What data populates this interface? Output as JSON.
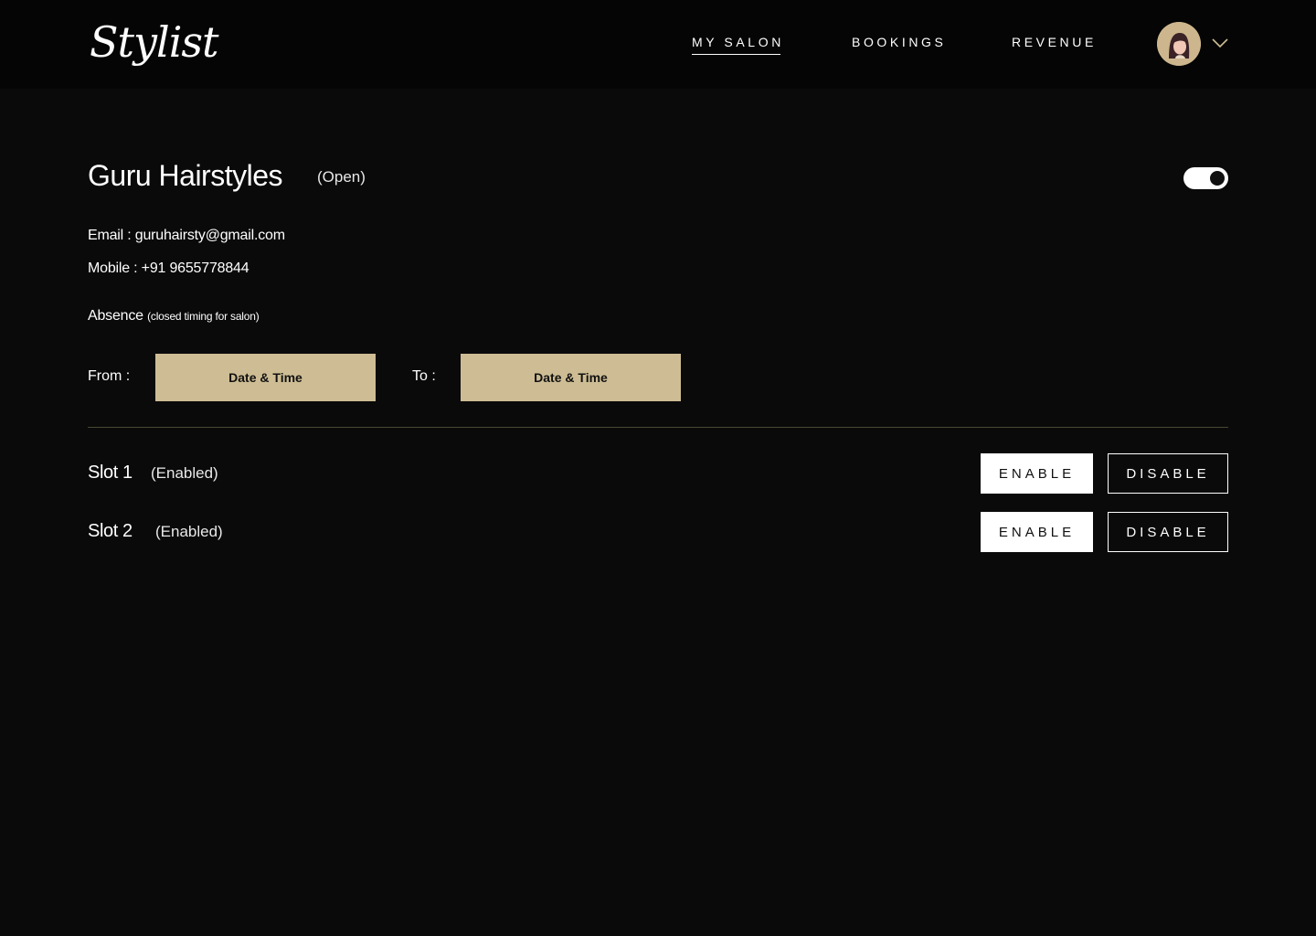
{
  "brand": {
    "logo_text": "Stylist"
  },
  "nav": {
    "items": [
      {
        "label": "MY SALON",
        "active": true
      },
      {
        "label": "BOOKINGS",
        "active": false
      },
      {
        "label": "REVENUE",
        "active": false
      }
    ]
  },
  "salon": {
    "name": "Guru Hairstyles",
    "status": "(Open)",
    "email_line": "Email : guruhairsty@gmail.com",
    "mobile_line": "Mobile : +91 9655778844",
    "open": true
  },
  "absence": {
    "label": "Absence",
    "note": "(closed timing for salon)",
    "from_label": "From :",
    "to_label": "To :",
    "from_button": "Date & Time",
    "to_button": "Date & Time"
  },
  "slots": [
    {
      "name": "Slot 1",
      "status": "(Enabled)",
      "enable_label": "ENABLE",
      "disable_label": "DISABLE"
    },
    {
      "name": "Slot 2",
      "status": "(Enabled)",
      "enable_label": "ENABLE",
      "disable_label": "DISABLE"
    }
  ],
  "colors": {
    "background": "#0a0a0a",
    "accent": "#cebd94",
    "divider": "#4a4834"
  }
}
